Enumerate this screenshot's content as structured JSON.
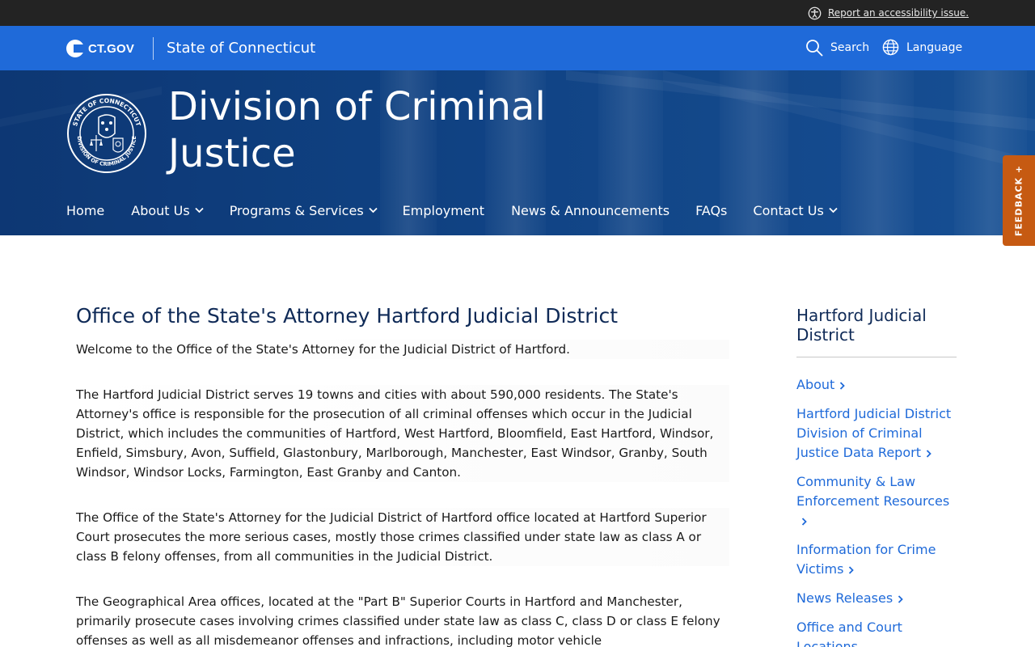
{
  "utility": {
    "accessibility_link": "Report an accessibility issue."
  },
  "gov_bar": {
    "logo_text": "CT.GOV",
    "state_name": "State of Connecticut",
    "search_label": "Search",
    "language_label": "Language"
  },
  "hero": {
    "title_line1": "Division of Criminal",
    "title_line2": "Justice",
    "seal_alt": "State of Connecticut Division of Criminal Justice seal"
  },
  "nav": {
    "items": [
      {
        "label": "Home",
        "has_dropdown": false
      },
      {
        "label": "About Us",
        "has_dropdown": true
      },
      {
        "label": "Programs & Services",
        "has_dropdown": true
      },
      {
        "label": "Employment",
        "has_dropdown": false
      },
      {
        "label": "News & Announcements",
        "has_dropdown": false
      },
      {
        "label": "FAQs",
        "has_dropdown": false
      },
      {
        "label": "Contact Us",
        "has_dropdown": true
      }
    ]
  },
  "feedback": {
    "label": "FEEDBACK +"
  },
  "main": {
    "title": "Office of the State's Attorney Hartford Judicial District",
    "paragraphs": [
      "Welcome to the Office of the State's Attorney for the Judicial District of Hartford.",
      "The Hartford Judicial District serves 19 towns and cities with about 590,000 residents. The State's Attorney's office is responsible for the prosecution of all criminal offenses which occur in the Judicial District, which includes the communities of Hartford, West Hartford, Bloomfield, East Hartford, Windsor, Enfield, Simsbury, Avon, Suffield, Glastonbury, Marlborough, Manchester, East Windsor, Granby, South Windsor, Windsor Locks, Farmington, East Granby and Canton.",
      "The Office of the State's Attorney for the Judicial District of Hartford office located at Hartford Superior Court prosecutes the more serious cases, mostly those crimes classified under state law as class A or class B felony offenses, from all communities in the Judicial District.",
      "The Geographical Area offices, located at the \"Part B\" Superior Courts in Hartford and Manchester, primarily prosecute cases involving crimes classified under state law as class C, class D or class E felony offenses as well as all misdemeanor offenses and infractions, including motor vehicle"
    ]
  },
  "sidebar": {
    "title": "Hartford Judicial District",
    "links": [
      "About",
      "Hartford Judicial District Division of Criminal Justice Data Report",
      "Community & Law Enforcement Resources",
      "Information for Crime Victims",
      "News Releases",
      "Office and Court Locations"
    ]
  },
  "colors": {
    "utility_bg": "#232323",
    "gov_bar_bg": "#1f6ad9",
    "hero_bg": "#13498f",
    "feedback_bg": "#c65a12",
    "heading": "#0f2a57",
    "link": "#1f6ad9"
  },
  "icons": {
    "accessibility": "accessibility-icon",
    "search": "search-icon",
    "language": "globe-icon",
    "dropdown": "chevron-down-icon",
    "sidebar_arrow": "chevron-right-icon"
  }
}
